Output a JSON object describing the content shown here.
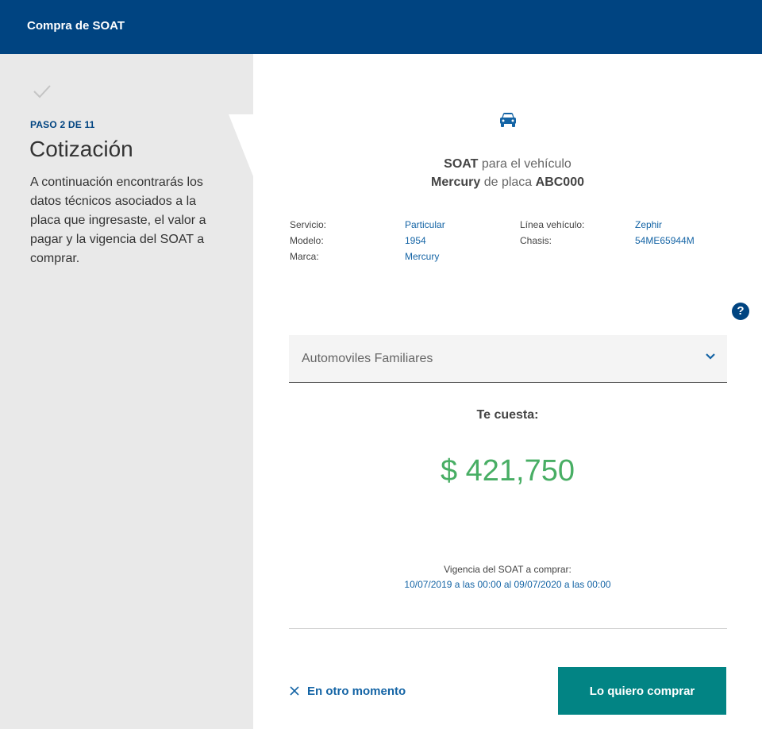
{
  "header": {
    "title": "Compra de SOAT"
  },
  "sidebar": {
    "step": "PASO 2 DE 11",
    "title": "Cotización",
    "description": "A continuación encontrarás los datos técnicos asociados a la placa que ingresaste, el valor a pagar y la vigencia del SOAT a comprar."
  },
  "vehicle": {
    "line1_bold": "SOAT",
    "line1_rest": " para el vehículo",
    "brand": "Mercury",
    "plate_prefix": " de placa ",
    "plate": "ABC000"
  },
  "specs": {
    "servicio": {
      "label": "Servicio:",
      "value": "Particular"
    },
    "modelo": {
      "label": "Modelo:",
      "value": "1954"
    },
    "marca": {
      "label": "Marca:",
      "value": "Mercury"
    },
    "linea": {
      "label": "Línea vehículo:",
      "value": "Zephir"
    },
    "chasis": {
      "label": "Chasis:",
      "value": "54ME65944M"
    }
  },
  "help": {
    "symbol": "?"
  },
  "vehicle_type": {
    "selected": "Automoviles Familiares"
  },
  "cost": {
    "label": "Te cuesta:",
    "value": "$ 421,750"
  },
  "validity": {
    "label": "Vigencia del SOAT a comprar:",
    "value": "10/07/2019 a las 00:00 al 09/07/2020 a las 00:00"
  },
  "actions": {
    "later": "En otro momento",
    "buy": "Lo quiero comprar"
  },
  "colors": {
    "primary": "#004481",
    "link": "#1464a5",
    "price": "#48ae64",
    "button": "#028484",
    "sidebar_bg": "#e9e9e9"
  }
}
